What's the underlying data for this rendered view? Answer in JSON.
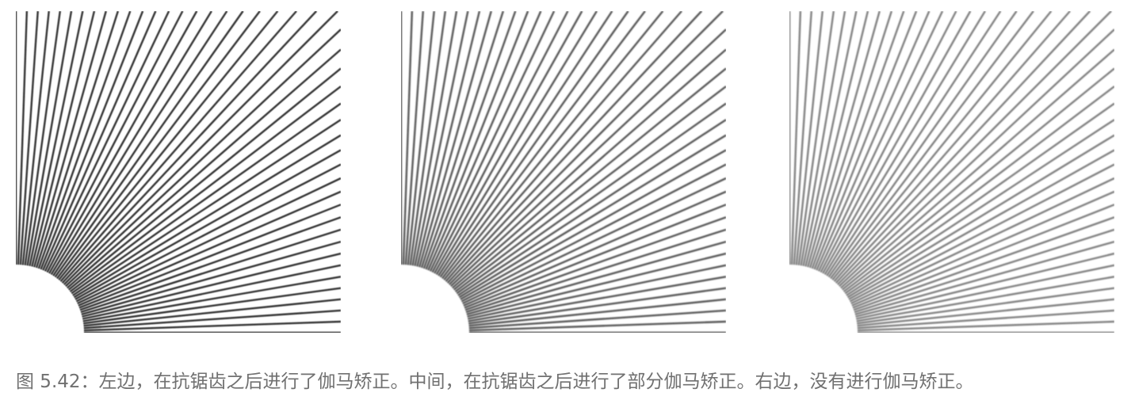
{
  "figure": {
    "caption": "图 5.42：左边，在抗锯齿之后进行了伽马矫正。中间，在抗锯齿之后进行了部分伽马矫正。右边，没有进行伽马矫正。",
    "panels": [
      {
        "id": "left",
        "gamma": "full",
        "line_color": "#2a2a2a",
        "opacity": 0.95
      },
      {
        "id": "middle",
        "gamma": "partial",
        "line_color": "#3a3a3a",
        "opacity": 0.85
      },
      {
        "id": "right",
        "gamma": "none",
        "line_color": "#555555",
        "opacity": 0.75
      }
    ]
  }
}
